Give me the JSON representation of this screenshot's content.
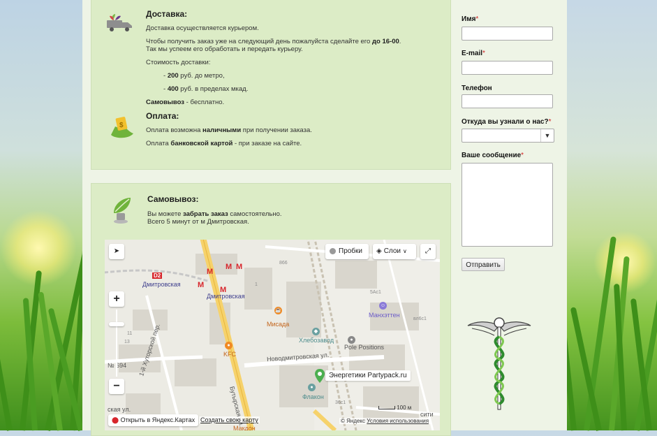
{
  "delivery": {
    "title": "Доставка:",
    "line1": "Доставка осуществляется курьером.",
    "line2_pre": "Чтобы получить заказ уже на следующий день пожалуйста сделайте его ",
    "line2_bold": "до 16-00",
    "line2_post": ".",
    "line3": "Так мы успеем его обработать и передать курьеру.",
    "cost_heading": "Стоимость доставки:",
    "cost1_pre": "- ",
    "cost1_bold": "200",
    "cost1_post": " руб. до метро,",
    "cost2_pre": "- ",
    "cost2_bold": "400",
    "cost2_post": " руб. в пределах мкад.",
    "self_bold": "Самовывоз",
    "self_post": " - бесплатно.",
    "icon": "delivery-truck-icon"
  },
  "payment": {
    "title": "Оплата:",
    "line1_pre": "Оплата возможна ",
    "line1_bold": "наличными",
    "line1_post": " при получении заказа.",
    "line2_pre": "Оплата ",
    "line2_bold": "банковской картой",
    "line2_post": " - при заказе на сайте.",
    "icon": "payment-money-icon"
  },
  "pickup": {
    "title": "Самовывоз:",
    "line1_pre": "Вы можете ",
    "line1_bold": "забрать заказ",
    "line1_post": " самостоятельно.",
    "line2": "Всего 5 минут от м Дмитровская.",
    "icon": "pickup-leaf-icon"
  },
  "form": {
    "name_label": "Имя",
    "email_label": "E-mail",
    "phone_label": "Телефон",
    "source_label": "Откуда вы узнали о нас?",
    "message_label": "Ваше сообщение",
    "required_mark": "*",
    "submit_label": "Отправить"
  },
  "map": {
    "traffic_label": "Пробки",
    "layers_label": "Слои",
    "zoom_in": "+",
    "zoom_out": "−",
    "open_in_yandex": "Открыть в Яндекс.Картах",
    "create_map": "Создать свою карту",
    "copyright": "© Яндекс",
    "terms": "Условия использования",
    "scale": "100 м",
    "marker_label": "Энергетики Partypack.ru",
    "labels": {
      "d2": "D2",
      "dmitrovskaya1": "Дмитровская",
      "dmitrovskaya2": "Дмитровская",
      "misada": "Мисада",
      "khlebozavod": "Хлебозавод",
      "pole": "Pole Positions",
      "manhattan": "Манхэттен",
      "kfc": "KFC",
      "flakon": "Флакон",
      "novodmitrovskaya": "Новодмитровская ул.",
      "butyrskaya": "Бутырская ул.",
      "khutorskoy": "1-й Хуторской пер.",
      "sity": "сити",
      "n694": "№ 694",
      "street_bl": "ская ул.",
      "makdon": "Макдон"
    }
  },
  "colors": {
    "panel_bg": "#dcecc6",
    "required": "#d02020",
    "metro": "#d7262c",
    "road_yellow": "#f6d26b",
    "marker_green": "#4caf50"
  }
}
